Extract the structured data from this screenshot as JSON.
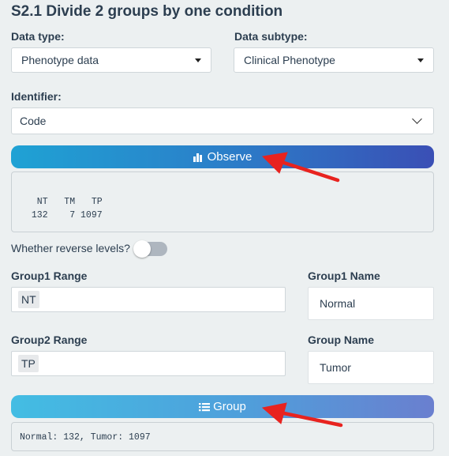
{
  "section_title": "S2.1 Divide 2 groups by one condition",
  "data_type": {
    "label": "Data type:",
    "value": "Phenotype data"
  },
  "data_subtype": {
    "label": "Data subtype:",
    "value": "Clinical Phenotype"
  },
  "identifier": {
    "label": "Identifier:",
    "value": "Code"
  },
  "observe_button": {
    "label": "Observe",
    "icon": "bar-chart-icon"
  },
  "observe_output": {
    "header": "  NT   TM   TP",
    "values": " 132    7 1097"
  },
  "reverse_levels": {
    "label": "Whether reverse levels?",
    "enabled": false
  },
  "group1": {
    "range_label": "Group1 Range",
    "range_value": "NT",
    "name_label": "Group1 Name",
    "name_value": "Normal"
  },
  "group2": {
    "range_label": "Group2 Range",
    "range_value": "TP",
    "name_label": "Group Name",
    "name_value": "Tumor"
  },
  "group_button": {
    "label": "Group",
    "icon": "list-icon"
  },
  "group_output": "Normal: 132, Tumor: 1097",
  "colors": {
    "arrow": "#e8231f",
    "observe_button": "#2b7fc9",
    "group_button": "#4f9fdb"
  }
}
